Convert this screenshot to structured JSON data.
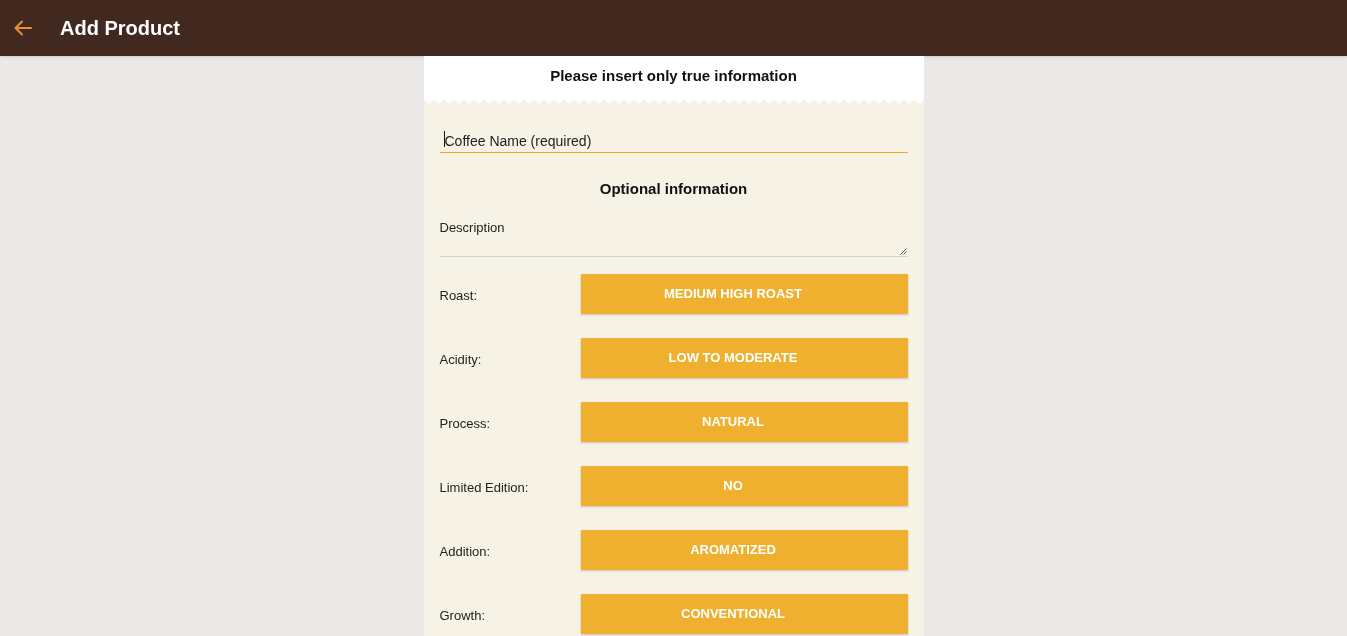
{
  "app_bar": {
    "title": "Add Product"
  },
  "notice": "Please insert only true information",
  "name_field": {
    "placeholder": "Coffee Name (required)",
    "focused": true
  },
  "section_title": "Optional information",
  "description_field": {
    "placeholder": "Description",
    "focused": false
  },
  "options": [
    {
      "label": "Roast:",
      "value": "MEDIUM HIGH ROAST"
    },
    {
      "label": "Acidity:",
      "value": "LOW TO MODERATE"
    },
    {
      "label": "Process:",
      "value": "NATURAL"
    },
    {
      "label": "Limited Edition:",
      "value": "NO"
    },
    {
      "label": "Addition:",
      "value": "AROMATIZED"
    },
    {
      "label": "Growth:",
      "value": "CONVENTIONAL"
    }
  ]
}
